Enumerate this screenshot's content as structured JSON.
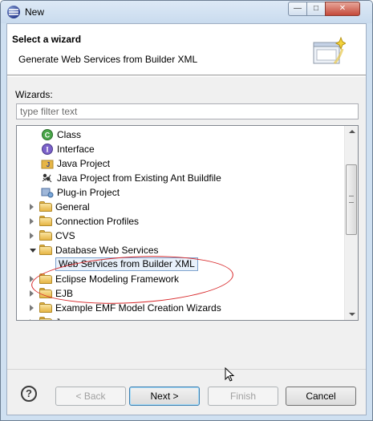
{
  "window": {
    "title": "New",
    "controls": {
      "minimize": "—",
      "maximize": "□",
      "close": "✕"
    }
  },
  "header": {
    "title": "Select a wizard",
    "description": "Generate Web Services from Builder XML"
  },
  "filter": {
    "label": "Wizards:",
    "placeholder": "type filter text",
    "value": ""
  },
  "tree": {
    "items": [
      {
        "label": "Class",
        "icon": "class-icon",
        "level": 2,
        "twisty": "none"
      },
      {
        "label": "Interface",
        "icon": "interface-icon",
        "level": 2,
        "twisty": "none"
      },
      {
        "label": "Java Project",
        "icon": "java-project-icon",
        "level": 2,
        "twisty": "none"
      },
      {
        "label": "Java Project from Existing Ant Buildfile",
        "icon": "ant-icon",
        "level": 2,
        "twisty": "none"
      },
      {
        "label": "Plug-in Project",
        "icon": "plugin-project-icon",
        "level": 2,
        "twisty": "none"
      },
      {
        "label": "General",
        "icon": "folder-icon",
        "level": 1,
        "twisty": "closed"
      },
      {
        "label": "Connection Profiles",
        "icon": "folder-icon",
        "level": 1,
        "twisty": "closed"
      },
      {
        "label": "CVS",
        "icon": "folder-icon",
        "level": 1,
        "twisty": "closed"
      },
      {
        "label": "Database Web Services",
        "icon": "folder-open-icon",
        "level": 1,
        "twisty": "open"
      },
      {
        "label": "Web Services from Builder XML",
        "icon": "",
        "level": 2,
        "twisty": "none",
        "selected": true
      },
      {
        "label": "Eclipse Modeling Framework",
        "icon": "folder-icon",
        "level": 1,
        "twisty": "closed"
      },
      {
        "label": "EJB",
        "icon": "folder-icon",
        "level": 1,
        "twisty": "closed"
      },
      {
        "label": "Example EMF Model Creation Wizards",
        "icon": "folder-icon",
        "level": 1,
        "twisty": "closed"
      },
      {
        "label": "Java",
        "icon": "folder-icon",
        "level": 1,
        "twisty": "closed"
      }
    ]
  },
  "buttons": {
    "help": "?",
    "back": "< Back",
    "next": "Next >",
    "finish": "Finish",
    "cancel": "Cancel"
  },
  "colors": {
    "annotation": "#d8282a",
    "selection_border": "#7da2ce",
    "window_frame": "#cfe0f1"
  }
}
